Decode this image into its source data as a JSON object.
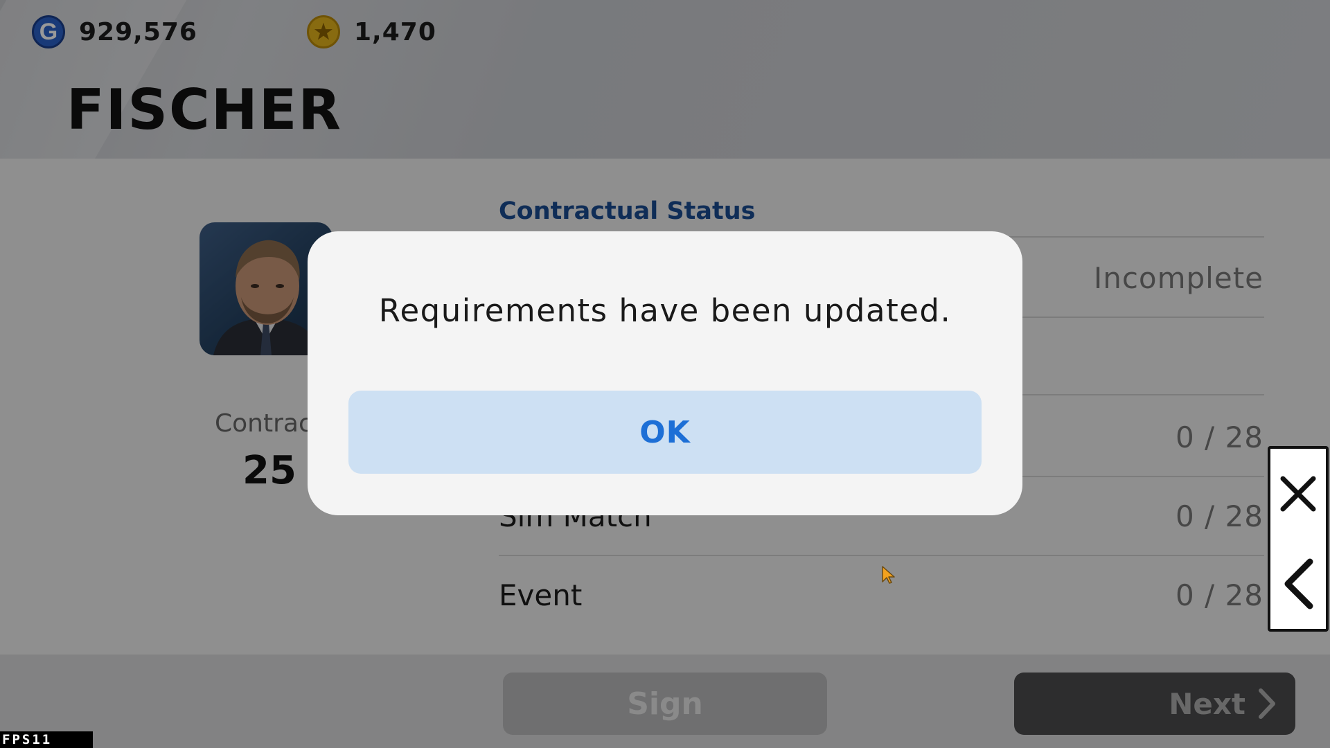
{
  "header": {
    "gp": {
      "icon": "gp-coin-icon",
      "amount": "929,576"
    },
    "coins": {
      "icon": "star-coin-icon",
      "amount": "1,470"
    },
    "title": "FISCHER"
  },
  "profile": {
    "contract_label": "Contrac",
    "contract_value": "25"
  },
  "status": {
    "section_title": "Contractual Status",
    "rows": [
      {
        "label": "",
        "value": "Incomplete"
      },
      {
        "label": "",
        "value": ""
      },
      {
        "label": "",
        "value": "0 / 28"
      },
      {
        "label": "Sim Match",
        "value": "0 / 28"
      },
      {
        "label": "Event",
        "value": "0 / 28"
      }
    ]
  },
  "footer": {
    "sign_label": "Sign",
    "next_label": "Next"
  },
  "dialog": {
    "message": "Requirements have been updated.",
    "ok_label": "OK"
  },
  "controls": {
    "close_icon": "close-icon",
    "back_icon": "back-chevron-icon"
  },
  "fps": {
    "label": "FPS",
    "value": "11"
  },
  "colors": {
    "accent_blue": "#1d6fd6",
    "section_title": "#1a4c92",
    "ok_button_bg": "#cde0f3"
  }
}
